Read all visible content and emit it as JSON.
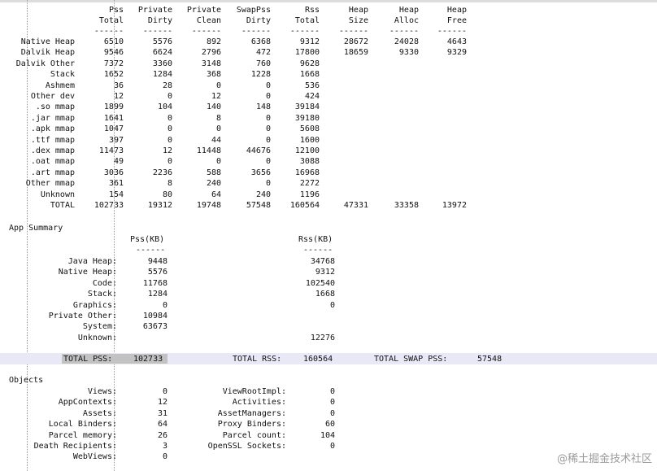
{
  "memory_table": {
    "header_row1": [
      "Pss",
      "Private",
      "Private",
      "SwapPss",
      "Rss",
      "Heap",
      "Heap",
      "Heap"
    ],
    "header_row2": [
      "Total",
      "Dirty",
      "Clean",
      "Dirty",
      "Total",
      "Size",
      "Alloc",
      "Free"
    ],
    "separator": [
      "------",
      "------",
      "------",
      "------",
      "------",
      "------",
      "------",
      "------"
    ],
    "rows": [
      {
        "label": "Native Heap",
        "values": [
          "6510",
          "5576",
          "892",
          "6368",
          "9312",
          "28672",
          "24028",
          "4643"
        ]
      },
      {
        "label": "Dalvik Heap",
        "values": [
          "9546",
          "6624",
          "2796",
          "472",
          "17800",
          "18659",
          "9330",
          "9329"
        ]
      },
      {
        "label": "Dalvik Other",
        "values": [
          "7372",
          "3360",
          "3148",
          "760",
          "9628",
          "",
          "",
          ""
        ]
      },
      {
        "label": "Stack",
        "values": [
          "1652",
          "1284",
          "368",
          "1228",
          "1668",
          "",
          "",
          ""
        ]
      },
      {
        "label": "Ashmem",
        "values": [
          "36",
          "28",
          "0",
          "0",
          "536",
          "",
          "",
          ""
        ]
      },
      {
        "label": "Other dev",
        "values": [
          "12",
          "0",
          "12",
          "0",
          "424",
          "",
          "",
          ""
        ]
      },
      {
        "label": ".so mmap",
        "values": [
          "1899",
          "104",
          "140",
          "148",
          "39184",
          "",
          "",
          ""
        ]
      },
      {
        "label": ".jar mmap",
        "values": [
          "1641",
          "0",
          "8",
          "0",
          "39180",
          "",
          "",
          ""
        ]
      },
      {
        "label": ".apk mmap",
        "values": [
          "1047",
          "0",
          "0",
          "0",
          "5608",
          "",
          "",
          ""
        ]
      },
      {
        "label": ".ttf mmap",
        "values": [
          "397",
          "0",
          "44",
          "0",
          "1600",
          "",
          "",
          ""
        ]
      },
      {
        "label": ".dex mmap",
        "values": [
          "11473",
          "12",
          "11448",
          "44676",
          "12100",
          "",
          "",
          ""
        ]
      },
      {
        "label": ".oat mmap",
        "values": [
          "49",
          "0",
          "0",
          "0",
          "3088",
          "",
          "",
          ""
        ]
      },
      {
        "label": ".art mmap",
        "values": [
          "3036",
          "2236",
          "588",
          "3656",
          "16968",
          "",
          "",
          ""
        ]
      },
      {
        "label": "Other mmap",
        "values": [
          "361",
          "8",
          "240",
          "0",
          "2272",
          "",
          "",
          ""
        ]
      },
      {
        "label": "Unknown",
        "values": [
          "154",
          "80",
          "64",
          "240",
          "1196",
          "",
          "",
          ""
        ]
      },
      {
        "label": "TOTAL",
        "values": [
          "102733",
          "19312",
          "19748",
          "57548",
          "160564",
          "47331",
          "33358",
          "13972"
        ]
      }
    ]
  },
  "app_summary": {
    "title": "App Summary",
    "pss_header": "Pss(KB)",
    "rss_header": "Rss(KB)",
    "separator": "------",
    "rows": [
      {
        "label": "Java Heap:",
        "pss": "9448",
        "rss": "34768"
      },
      {
        "label": "Native Heap:",
        "pss": "5576",
        "rss": "9312"
      },
      {
        "label": "Code:",
        "pss": "11768",
        "rss": "102540"
      },
      {
        "label": "Stack:",
        "pss": "1284",
        "rss": "1668"
      },
      {
        "label": "Graphics:",
        "pss": "0",
        "rss": "0"
      },
      {
        "label": "Private Other:",
        "pss": "10984",
        "rss": ""
      },
      {
        "label": "System:",
        "pss": "63673",
        "rss": ""
      },
      {
        "label": "Unknown:",
        "pss": "",
        "rss": "12276"
      }
    ],
    "totals": {
      "pss_label": "TOTAL PSS:",
      "pss_value": "102733",
      "rss_label": "TOTAL RSS:",
      "rss_value": "160564",
      "swap_label": "TOTAL SWAP PSS:",
      "swap_value": "57548"
    }
  },
  "objects": {
    "title": "Objects",
    "rows": [
      {
        "l_label": "Views:",
        "l_value": "0",
        "r_label": "ViewRootImpl:",
        "r_value": "0"
      },
      {
        "l_label": "AppContexts:",
        "l_value": "12",
        "r_label": "Activities:",
        "r_value": "0"
      },
      {
        "l_label": "Assets:",
        "l_value": "31",
        "r_label": "AssetManagers:",
        "r_value": "0"
      },
      {
        "l_label": "Local Binders:",
        "l_value": "64",
        "r_label": "Proxy Binders:",
        "r_value": "60"
      },
      {
        "l_label": "Parcel memory:",
        "l_value": "26",
        "r_label": "Parcel count:",
        "r_value": "104"
      },
      {
        "l_label": "Death Recipients:",
        "l_value": "3",
        "r_label": "OpenSSL Sockets:",
        "r_value": "0"
      },
      {
        "l_label": "WebViews:",
        "l_value": "0",
        "r_label": "",
        "r_value": ""
      }
    ]
  },
  "watermark": "@稀土掘金技术社区"
}
